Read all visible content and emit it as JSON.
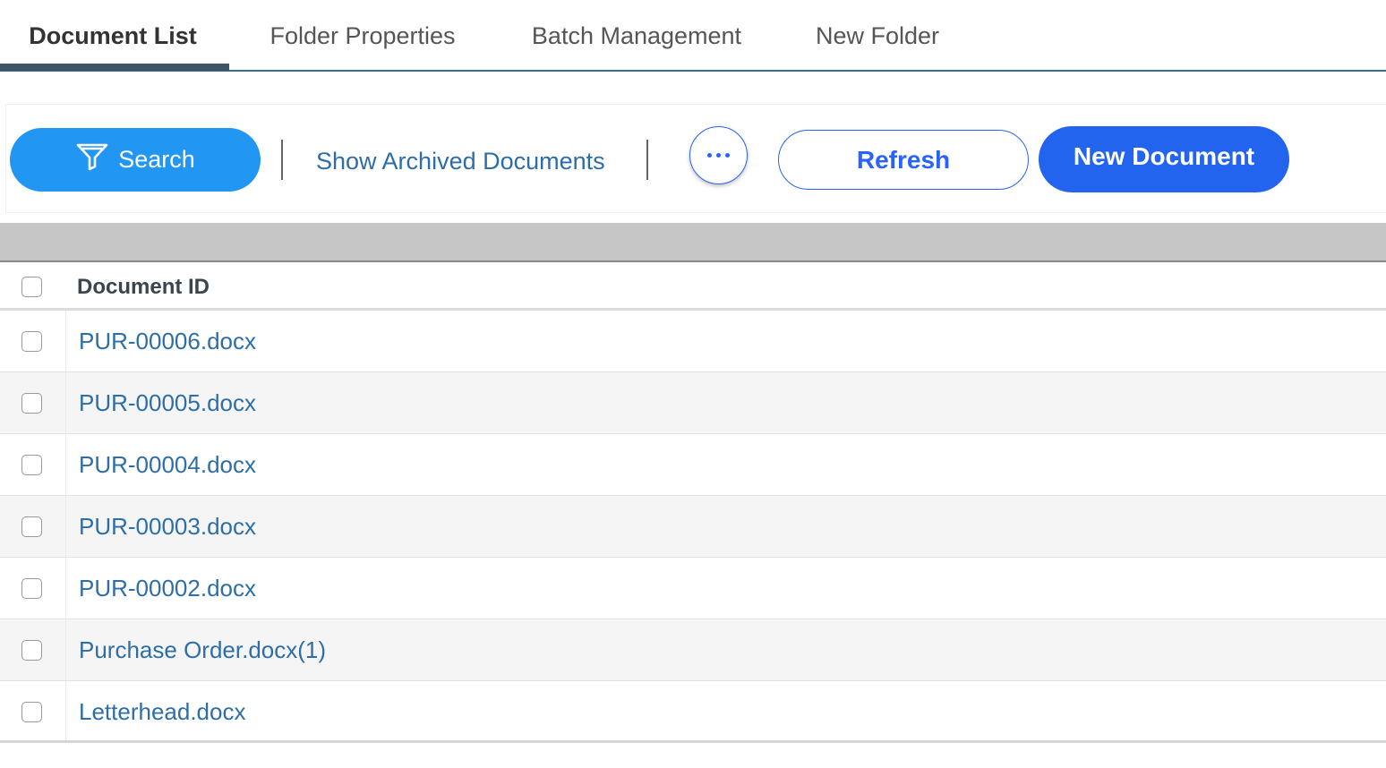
{
  "tabs": [
    {
      "label": "Document List",
      "active": true
    },
    {
      "label": "Folder Properties",
      "active": false
    },
    {
      "label": "Batch Management",
      "active": false
    },
    {
      "label": "New Folder",
      "active": false
    }
  ],
  "toolbar": {
    "search_label": "Search",
    "search_icon": "filter-icon",
    "archived_link": "Show Archived Documents",
    "more_icon": "ellipsis-icon",
    "refresh_label": "Refresh",
    "new_document_label": "New Document"
  },
  "table": {
    "columns": [
      "Document ID"
    ],
    "rows": [
      {
        "document_id": "PUR-00006.docx"
      },
      {
        "document_id": "PUR-00005.docx"
      },
      {
        "document_id": "PUR-00004.docx"
      },
      {
        "document_id": "PUR-00003.docx"
      },
      {
        "document_id": "PUR-00002.docx"
      },
      {
        "document_id": "Purchase Order.docx(1)"
      },
      {
        "document_id": "Letterhead.docx"
      }
    ]
  },
  "colors": {
    "primary": "#2196f3",
    "accent_blue": "#2364ef",
    "link": "#2d6ea8",
    "tab_underline": "#3f5566"
  }
}
